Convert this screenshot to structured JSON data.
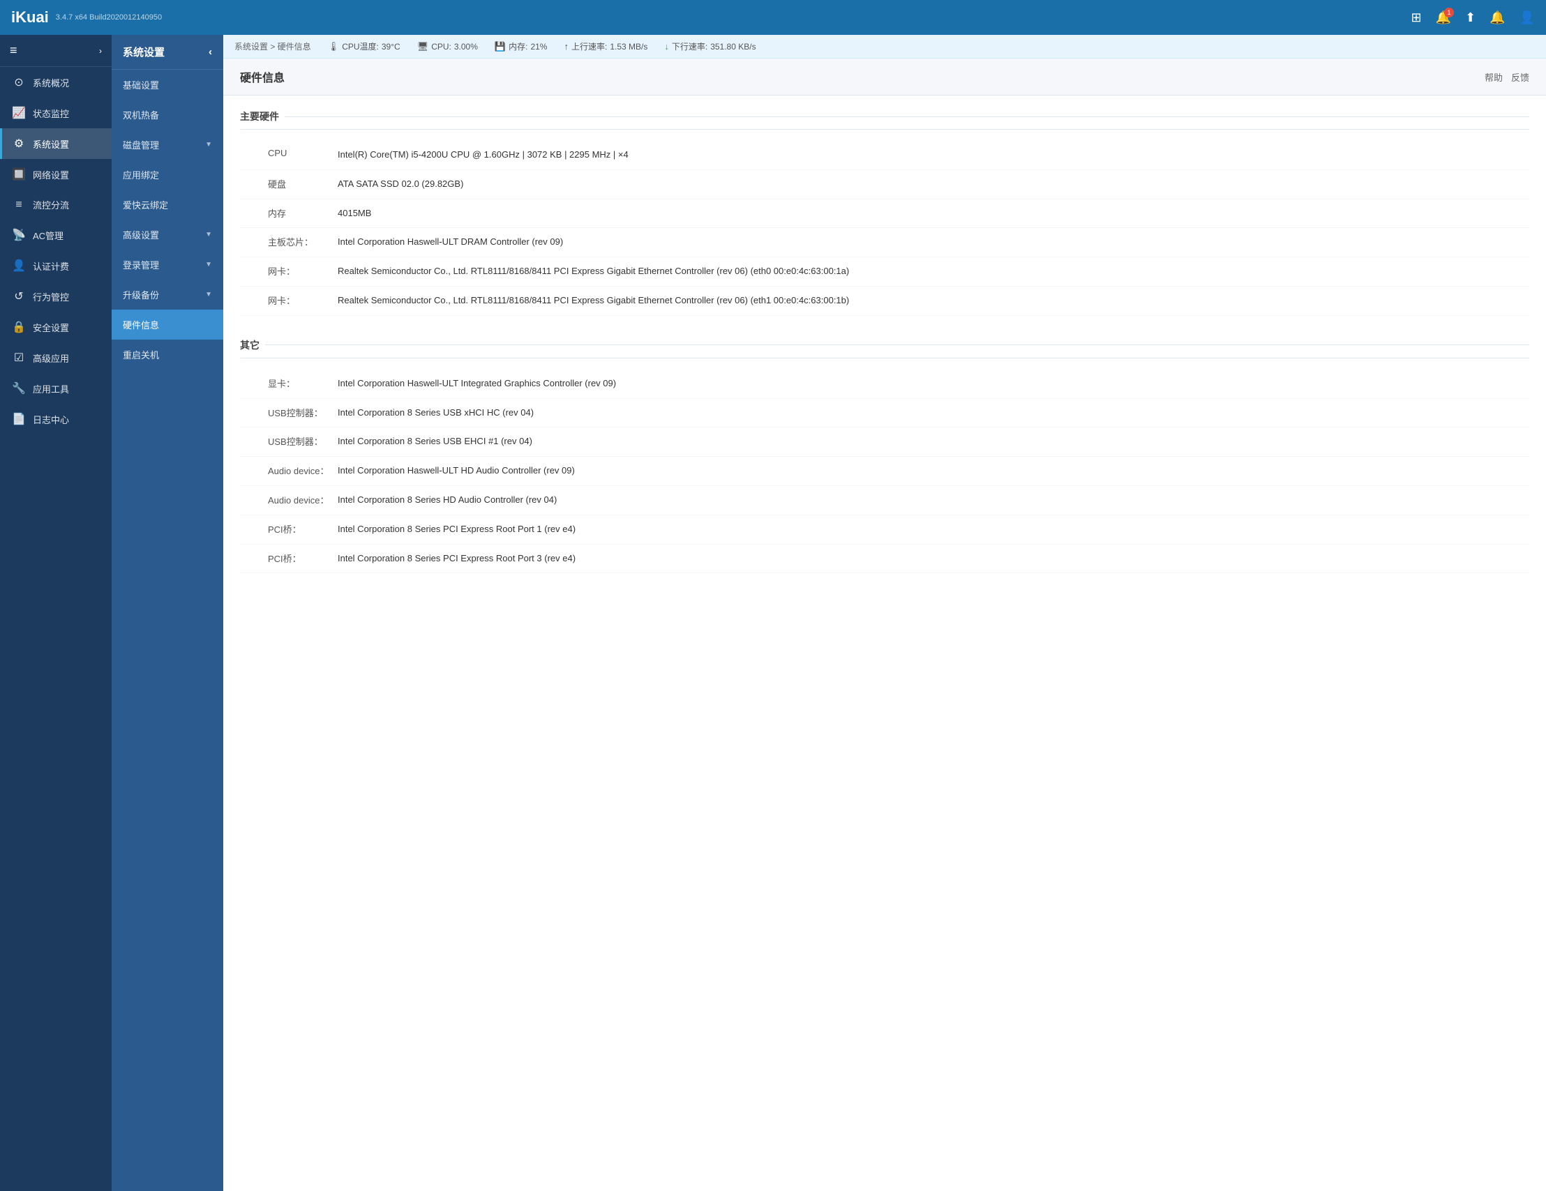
{
  "app": {
    "logo": "iKuai",
    "version": "3.4.7 x64 Build2020012140950"
  },
  "header": {
    "icons": [
      "grid-icon",
      "notification-icon",
      "upload-icon",
      "bell-icon",
      "user-icon"
    ],
    "notification_badge": "1"
  },
  "sidebar": {
    "collapse_label": "≡",
    "items": [
      {
        "id": "dashboard",
        "label": "系统概况",
        "icon": "⊙"
      },
      {
        "id": "monitor",
        "label": "状态监控",
        "icon": "📊"
      },
      {
        "id": "system",
        "label": "系统设置",
        "icon": "⚙",
        "active": true
      },
      {
        "id": "network",
        "label": "网络设置",
        "icon": "🔲"
      },
      {
        "id": "traffic",
        "label": "流控分流",
        "icon": "📶"
      },
      {
        "id": "ac",
        "label": "AC管理",
        "icon": "📡"
      },
      {
        "id": "auth",
        "label": "认证计费",
        "icon": "👤"
      },
      {
        "id": "behavior",
        "label": "行为管控",
        "icon": "↺"
      },
      {
        "id": "security",
        "label": "安全设置",
        "icon": "🔒"
      },
      {
        "id": "advanced",
        "label": "高级应用",
        "icon": "☑"
      },
      {
        "id": "tools",
        "label": "应用工具",
        "icon": "🔲"
      },
      {
        "id": "logs",
        "label": "日志中心",
        "icon": "📄"
      }
    ]
  },
  "sub_sidebar": {
    "title": "系统设置",
    "collapse_icon": "‹",
    "items": [
      {
        "id": "basic",
        "label": "基础设置",
        "has_arrow": false
      },
      {
        "id": "dual",
        "label": "双机热备",
        "has_arrow": false
      },
      {
        "id": "disk",
        "label": "磁盘管理",
        "has_arrow": true
      },
      {
        "id": "app_bind",
        "label": "应用绑定",
        "has_arrow": false
      },
      {
        "id": "cloud",
        "label": "爱快云绑定",
        "has_arrow": false
      },
      {
        "id": "advanced",
        "label": "高级设置",
        "has_arrow": true
      },
      {
        "id": "login",
        "label": "登录管理",
        "has_arrow": true
      },
      {
        "id": "upgrade",
        "label": "升级备份",
        "has_arrow": true
      },
      {
        "id": "hardware",
        "label": "硬件信息",
        "active": true,
        "has_arrow": false
      },
      {
        "id": "reboot",
        "label": "重启关机",
        "has_arrow": false
      }
    ]
  },
  "status_bar": {
    "breadcrumb": "系统设置 > 硬件信息",
    "cpu_temp_label": "CPU温度:",
    "cpu_temp_value": "39°C",
    "cpu_label": "CPU:",
    "cpu_value": "3.00%",
    "mem_label": "内存:",
    "mem_value": "21%",
    "upload_label": "上行速率:",
    "upload_value": "1.53 MB/s",
    "download_label": "下行速率:",
    "download_value": "351.80 KB/s"
  },
  "page": {
    "title": "硬件信息",
    "actions": [
      "帮助",
      "反馈"
    ]
  },
  "main_hardware": {
    "section_title": "主要硬件",
    "rows": [
      {
        "label": "CPU",
        "value": "Intel(R) Core(TM) i5-4200U CPU @ 1.60GHz | 3072 KB | 2295 MHz | ×4"
      },
      {
        "label": "硬盘",
        "value": "ATA SATA SSD 02.0 (29.82GB)"
      },
      {
        "label": "内存",
        "value": "4015MB"
      },
      {
        "label": "主板芯片：",
        "value": "Intel Corporation Haswell-ULT DRAM Controller (rev 09)"
      },
      {
        "label": "网卡：",
        "value": "Realtek Semiconductor Co., Ltd. RTL8111/8168/8411 PCI Express Gigabit Ethernet Controller (rev 06) (eth0 00:e0:4c:63:00:1a)"
      },
      {
        "label": "网卡：",
        "value": "Realtek Semiconductor Co., Ltd. RTL8111/8168/8411 PCI Express Gigabit Ethernet Controller (rev 06) (eth1 00:e0:4c:63:00:1b)"
      }
    ]
  },
  "other_hardware": {
    "section_title": "其它",
    "rows": [
      {
        "label": "显卡：",
        "value": "Intel Corporation Haswell-ULT Integrated Graphics Controller (rev 09)"
      },
      {
        "label": "USB控制器：",
        "value": "Intel Corporation 8 Series USB xHCI HC (rev 04)"
      },
      {
        "label": "USB控制器：",
        "value": "Intel Corporation 8 Series USB EHCI #1 (rev 04)"
      },
      {
        "label": "Audio device：",
        "value": "Intel Corporation Haswell-ULT HD Audio Controller (rev 09)"
      },
      {
        "label": "Audio device：",
        "value": "Intel Corporation 8 Series HD Audio Controller (rev 04)"
      },
      {
        "label": "PCI桥：",
        "value": "Intel Corporation 8 Series PCI Express Root Port 1 (rev e4)"
      },
      {
        "label": "PCI桥：",
        "value": "Intel Corporation 8 Series PCI Express Root Port 3 (rev e4)"
      }
    ]
  }
}
